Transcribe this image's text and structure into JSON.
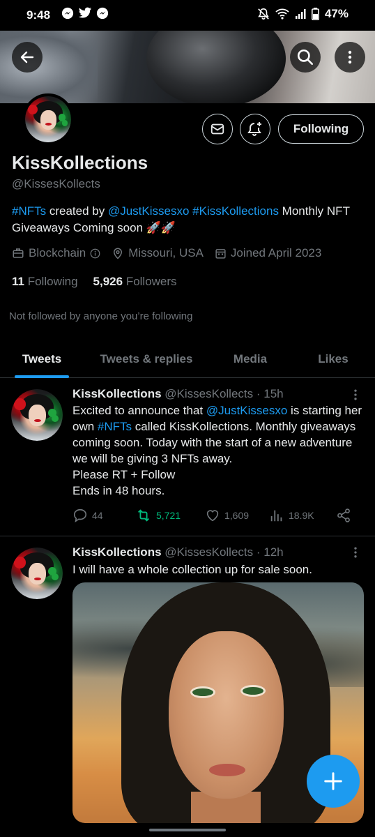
{
  "status_bar": {
    "time": "9:48",
    "battery": "47%"
  },
  "profile": {
    "name": "KissKollections",
    "handle": "@KissesKollects",
    "bio": {
      "hashtag1": "#NFTs",
      "text1": " created by ",
      "mention": "@JustKissesxo",
      "hashtag2": "#KissKollections",
      "text2": " Monthly NFT Giveaways Coming soon 🚀🚀"
    },
    "category": "Blockchain",
    "location": "Missouri, USA",
    "joined": "Joined April 2023",
    "following_count": "11",
    "following_label": "Following",
    "followers_count": "5,926",
    "followers_label": "Followers",
    "not_followed": "Not followed by anyone you’re following",
    "following_button": "Following"
  },
  "tabs": [
    {
      "label": "Tweets"
    },
    {
      "label": "Tweets & replies"
    },
    {
      "label": "Media"
    },
    {
      "label": "Likes"
    }
  ],
  "tweets": [
    {
      "name": "KissKollections",
      "handle": "@KissesKollects",
      "time": "· 15h",
      "text_a": "Excited to announce that ",
      "mention": "@JustKissesxo",
      "text_b": " is starting her own ",
      "hashtag": "#NFTs",
      "text_c": " called KissKollections. Monthly giveaways coming soon. Today with the start of a new adventure we will be giving 3 NFTs away.",
      "line2": "Please RT + Follow",
      "line3": "Ends in 48 hours.",
      "replies": "44",
      "retweets": "5,721",
      "likes": "1,609",
      "views": "18.9K"
    },
    {
      "name": "KissKollections",
      "handle": "@KissesKollects",
      "time": "· 12h",
      "text": "I will have a whole collection up for sale soon."
    }
  ],
  "colors": {
    "accent": "#1d9bf0",
    "retweet_green": "#00ba7c",
    "muted": "#71767b",
    "background": "#000000"
  },
  "icons": [
    "back-arrow-icon",
    "search-icon",
    "more-vertical-icon",
    "mail-icon",
    "bell-plus-icon",
    "briefcase-icon",
    "info-icon",
    "location-pin-icon",
    "calendar-icon",
    "reply-icon",
    "retweet-icon",
    "heart-icon",
    "views-icon",
    "share-icon",
    "compose-plus-icon"
  ]
}
